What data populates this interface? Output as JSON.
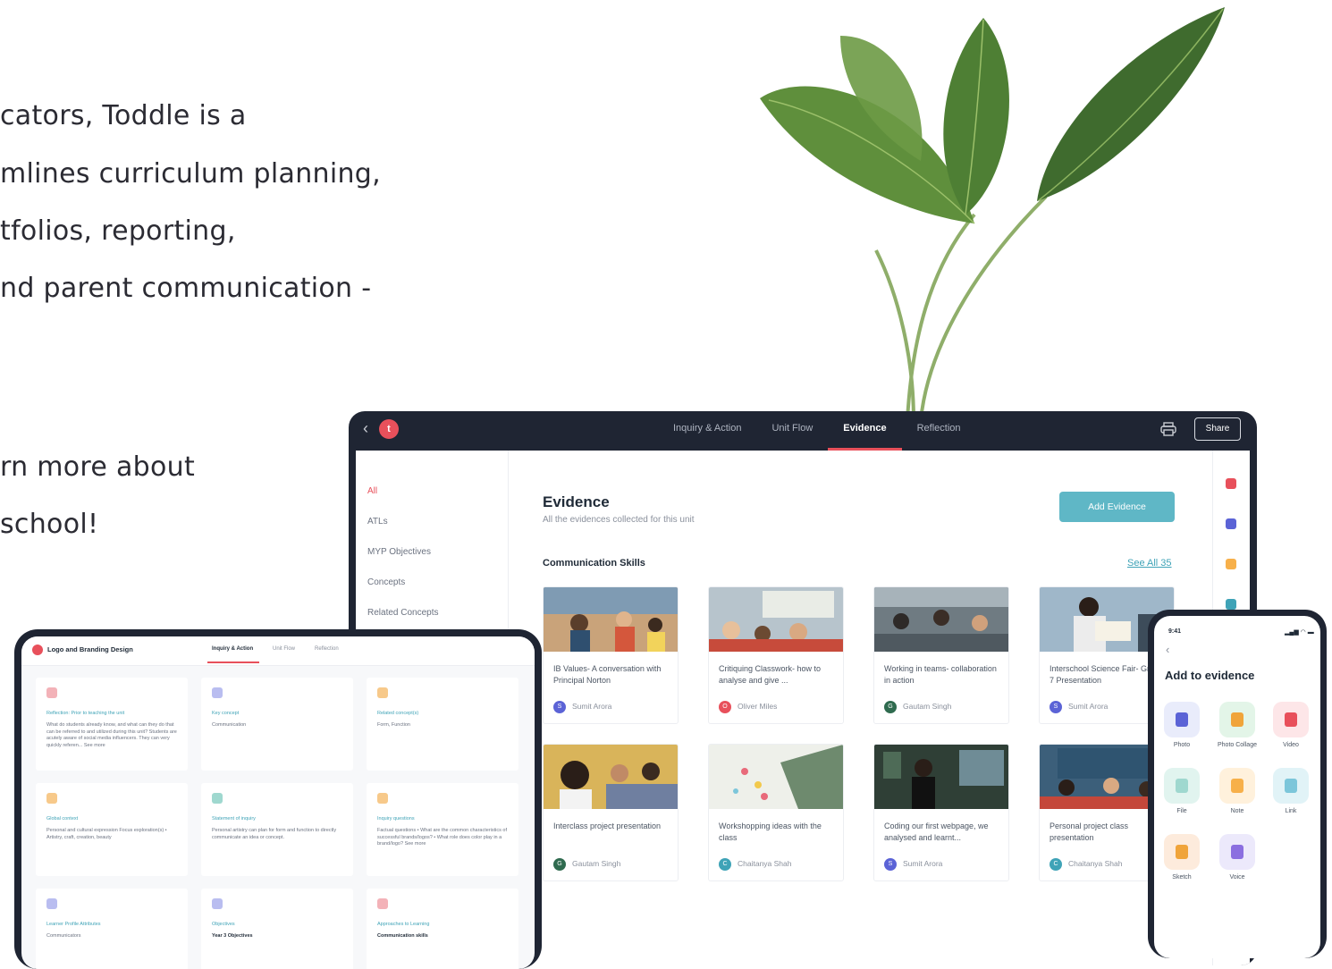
{
  "intro": {
    "lines": [
      "cators, Toddle is a",
      "mlines curriculum planning,",
      "tfolios, reporting,",
      "nd parent communication -",
      "rn more about",
      "school!"
    ]
  },
  "laptop": {
    "logo": "t",
    "tabs": [
      "Inquiry & Action",
      "Unit Flow",
      "Evidence",
      "Reflection"
    ],
    "active_tab": "Evidence",
    "share_label": "Share",
    "sidebar": [
      "All",
      "ATLs",
      "MYP Objectives",
      "Concepts",
      "Related Concepts"
    ],
    "title": "Evidence",
    "subtitle": "All the evidences collected for this unit",
    "add_button": "Add Evidence",
    "section": "Communication Skills",
    "see_all": "See All 35",
    "cards": [
      {
        "title": "IB Values- A conversation with Principal Norton",
        "initial": "S",
        "author": "Sumit Arora",
        "avatar_color": "#5b63d6"
      },
      {
        "title": "Critiquing Classwork- how to analyse and give ...",
        "initial": "O",
        "author": "Oliver Miles",
        "avatar_color": "#e8505b"
      },
      {
        "title": "Working in teams- collaboration in action",
        "initial": "G",
        "author": "Gautam Singh",
        "avatar_color": "#2f6b4f"
      },
      {
        "title": "Interschool Science Fair- Grade 7 Presentation",
        "initial": "S",
        "author": "Sumit Arora",
        "avatar_color": "#5b63d6"
      },
      {
        "title": "Interclass project presentation",
        "initial": "G",
        "author": "Gautam Singh",
        "avatar_color": "#2f6b4f"
      },
      {
        "title": "Workshopping ideas with the class",
        "initial": "C",
        "author": "Chaitanya Shah",
        "avatar_color": "#3fa3b7"
      },
      {
        "title": "Coding our first webpage, we analysed and learnt...",
        "initial": "S",
        "author": "Sumit Arora",
        "avatar_color": "#5b63d6"
      },
      {
        "title": "Personal project class presentation",
        "initial": "C",
        "author": "Chaitanya Shah",
        "avatar_color": "#3fa3b7"
      }
    ]
  },
  "tablet": {
    "title": "Logo and Branding Design",
    "tabs": [
      "Inquiry & Action",
      "Unit Flow",
      "Reflection"
    ],
    "cards": [
      {
        "label": "Reflection: Prior to teaching the unit",
        "body": "What do students already know, and what can they do that can be referred to and utilized during this unit? Students are acutely aware of social media influencers. They can very quickly referen... See more",
        "icon_color": "#f3b2b8"
      },
      {
        "label": "Key concept",
        "body": "Communication",
        "icon_color": "#b9bdf0"
      },
      {
        "label": "Related concept(s)",
        "body": "Form, Function",
        "icon_color": "#f7c98a"
      },
      {
        "label": "Global context",
        "body": "Personal and cultural expression  Focus exploration(s)  • Artistry, craft, creation, beauty",
        "icon_color": "#f7c98a"
      },
      {
        "label": "Statement of inquiry",
        "body": "Personal artistry can plan for form and function to directly communicate an idea or concept.",
        "icon_color": "#9fd8cf"
      },
      {
        "label": "Inquiry questions",
        "body": "Factual questions • What are the common characteristics of successful brands/logos? • What role does color play in a brand/logo? See more",
        "icon_color": "#f7c98a"
      },
      {
        "label": "Learner Profile Attributes",
        "body": "Communicators",
        "icon_color": "#b9bdf0"
      },
      {
        "label": "Objectives",
        "body": "Year 3 Objectives",
        "icon_color": "#b9bdf0"
      },
      {
        "label": "Approaches to Learning",
        "body": "Communication skills",
        "icon_color": "#f3b2b8"
      }
    ]
  },
  "phone": {
    "time": "9:41",
    "status": "▂▄▆ ◠ ▬",
    "title": "Add to evidence",
    "options": [
      {
        "label": "Photo",
        "bg": "#e9ecfb",
        "fg": "#5b63d6"
      },
      {
        "label": "Photo Collage",
        "bg": "#e3f5e8",
        "fg": "#f0a43a"
      },
      {
        "label": "Video",
        "bg": "#fde6e8",
        "fg": "#e8505b"
      },
      {
        "label": "File",
        "bg": "#e1f4ef",
        "fg": "#9fd8cf"
      },
      {
        "label": "Note",
        "bg": "#fff1dc",
        "fg": "#f7b04a"
      },
      {
        "label": "Link",
        "bg": "#e1f3f7",
        "fg": "#7cc6da"
      },
      {
        "label": "Sketch",
        "bg": "#fdebdc",
        "fg": "#f0a43a"
      },
      {
        "label": "Voice",
        "bg": "#ece9fb",
        "fg": "#8b6fe0"
      }
    ]
  }
}
